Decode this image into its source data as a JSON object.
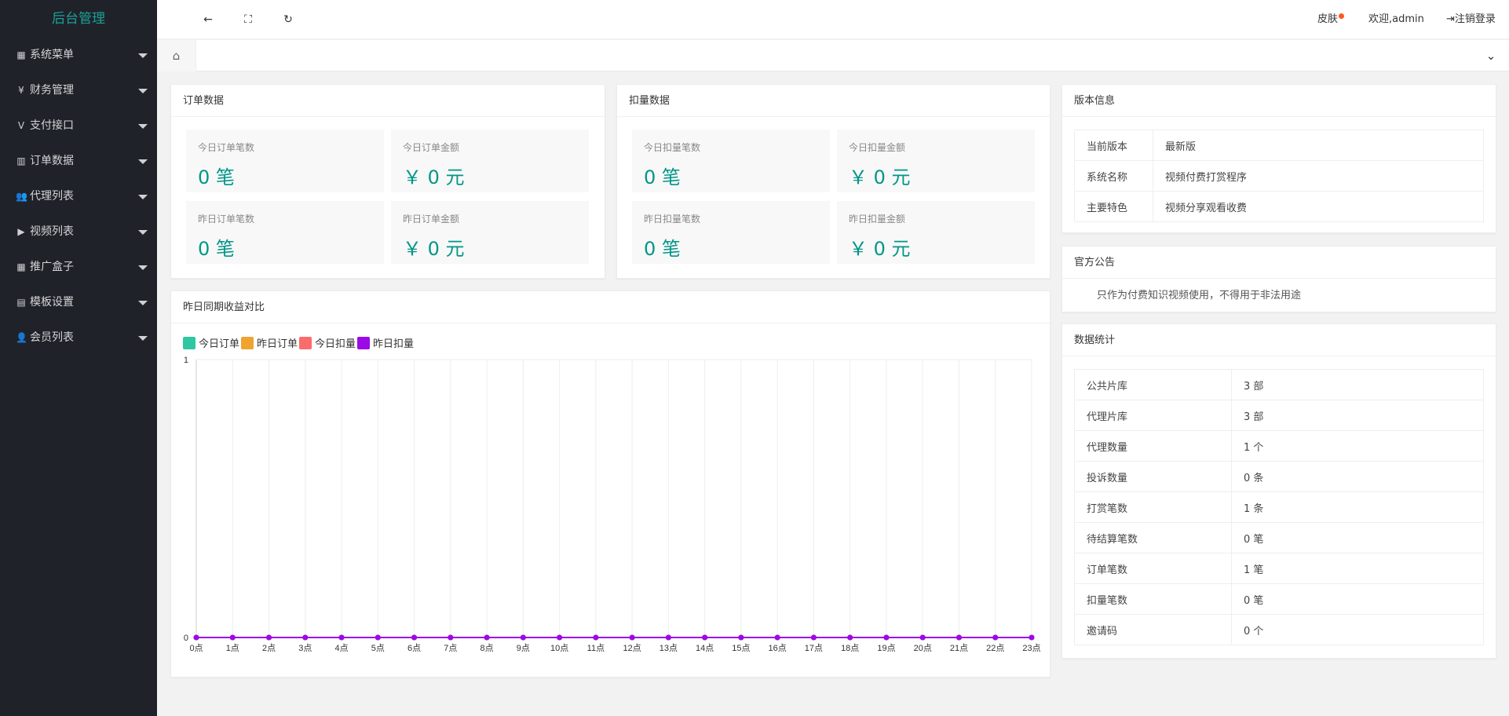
{
  "sidebar": {
    "logo": "后台管理",
    "items": [
      {
        "label": "系统菜单",
        "icon": "▦"
      },
      {
        "label": "财务管理",
        "icon": "¥"
      },
      {
        "label": "支付接口",
        "icon": "V"
      },
      {
        "label": "订单数据",
        "icon": "▥"
      },
      {
        "label": "代理列表",
        "icon": "👥"
      },
      {
        "label": "视频列表",
        "icon": "▶"
      },
      {
        "label": "推广盒子",
        "icon": "▦"
      },
      {
        "label": "模板设置",
        "icon": "▤"
      },
      {
        "label": "会员列表",
        "icon": "👤"
      }
    ]
  },
  "topbar": {
    "back_icon": "←",
    "fullscreen_icon": "⛶",
    "refresh_icon": "↻",
    "skin_label": "皮肤",
    "welcome": "欢迎,admin",
    "logout": "注销登录",
    "logout_icon": "⇥"
  },
  "tabbar": {
    "home_icon": "⌂",
    "dropdown_icon": "⌄"
  },
  "orders": {
    "title": "订单数据",
    "stats": [
      {
        "label": "今日订单笔数",
        "value": "0 笔"
      },
      {
        "label": "今日订单金额",
        "value": "￥ 0 元"
      },
      {
        "label": "昨日订单笔数",
        "value": "0 笔"
      },
      {
        "label": "昨日订单金额",
        "value": "￥ 0 元"
      }
    ]
  },
  "deductions": {
    "title": "扣量数据",
    "stats": [
      {
        "label": "今日扣量笔数",
        "value": "0 笔"
      },
      {
        "label": "今日扣量金额",
        "value": "￥ 0 元"
      },
      {
        "label": "昨日扣量笔数",
        "value": "0 笔"
      },
      {
        "label": "昨日扣量金额",
        "value": "￥ 0 元"
      }
    ]
  },
  "version": {
    "title": "版本信息",
    "rows": [
      {
        "k": "当前版本",
        "v": "最新版"
      },
      {
        "k": "系统名称",
        "v": "视频付费打赏程序"
      },
      {
        "k": "主要特色",
        "v": "视频分享观看收费"
      }
    ]
  },
  "notice": {
    "title": "官方公告",
    "text": "只作为付费知识视频使用，不得用于非法用途"
  },
  "stats": {
    "title": "数据统计",
    "rows": [
      {
        "k": "公共片库",
        "v": "3 部"
      },
      {
        "k": "代理片库",
        "v": "3 部"
      },
      {
        "k": "代理数量",
        "v": "1 个"
      },
      {
        "k": "投诉数量",
        "v": "0 条"
      },
      {
        "k": "打赏笔数",
        "v": "1 条"
      },
      {
        "k": "待结算笔数",
        "v": "0 笔"
      },
      {
        "k": "订单笔数",
        "v": "1 笔"
      },
      {
        "k": "扣量笔数",
        "v": "0 笔"
      },
      {
        "k": "邀请码",
        "v": "0 个"
      }
    ]
  },
  "chart_panel": {
    "title": "昨日同期收益对比"
  },
  "chart_data": {
    "type": "line",
    "title": "",
    "categories": [
      "0点",
      "1点",
      "2点",
      "3点",
      "4点",
      "5点",
      "6点",
      "7点",
      "8点",
      "9点",
      "10点",
      "11点",
      "12点",
      "13点",
      "14点",
      "15点",
      "16点",
      "17点",
      "18点",
      "19点",
      "20点",
      "21点",
      "22点",
      "23点"
    ],
    "series": [
      {
        "name": "今日订单",
        "color": "#2ec7a1",
        "values": [
          0,
          0,
          0,
          0,
          0,
          0,
          0,
          0,
          0,
          0,
          0,
          0,
          0,
          0,
          0,
          0,
          0,
          0,
          0,
          0,
          0,
          0,
          0,
          0
        ]
      },
      {
        "name": "昨日订单",
        "color": "#f0a32f",
        "values": [
          0,
          0,
          0,
          0,
          0,
          0,
          0,
          0,
          0,
          0,
          0,
          0,
          0,
          0,
          0,
          0,
          0,
          0,
          0,
          0,
          0,
          0,
          0,
          0
        ]
      },
      {
        "name": "今日扣量",
        "color": "#fc6b6b",
        "values": [
          0,
          0,
          0,
          0,
          0,
          0,
          0,
          0,
          0,
          0,
          0,
          0,
          0,
          0,
          0,
          0,
          0,
          0,
          0,
          0,
          0,
          0,
          0,
          0
        ]
      },
      {
        "name": "昨日扣量",
        "color": "#9b0ae6",
        "values": [
          0,
          0,
          0,
          0,
          0,
          0,
          0,
          0,
          0,
          0,
          0,
          0,
          0,
          0,
          0,
          0,
          0,
          0,
          0,
          0,
          0,
          0,
          0,
          0
        ]
      }
    ],
    "ylim": [
      0,
      1
    ],
    "yticks": [
      "0",
      "1"
    ],
    "grid": true,
    "legend": "top-left"
  }
}
